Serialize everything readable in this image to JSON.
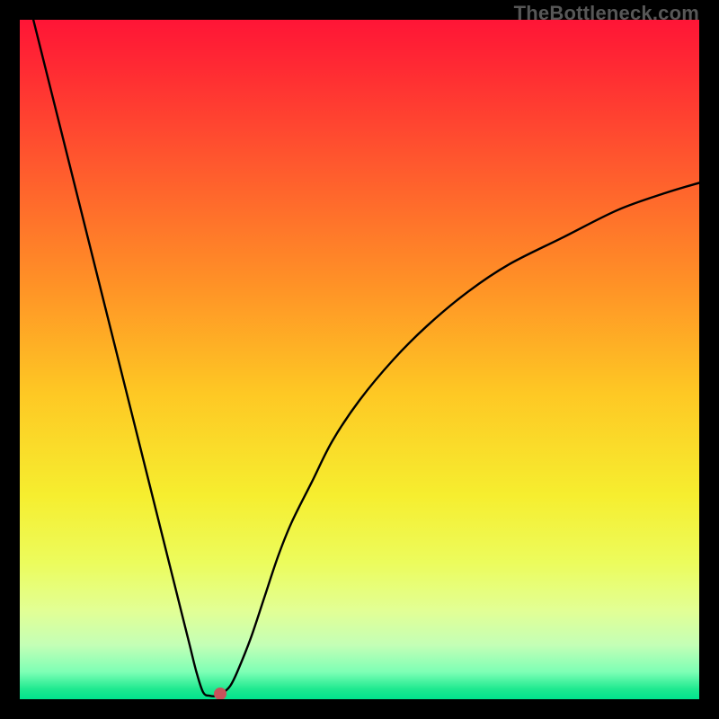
{
  "watermark": "TheBottleneck.com",
  "chart_data": {
    "type": "line",
    "title": "",
    "xlabel": "",
    "ylabel": "",
    "xlim": [
      0,
      100
    ],
    "ylim": [
      0,
      100
    ],
    "background": {
      "type": "vertical-gradient",
      "stops": [
        {
          "offset": 0.0,
          "color": "#ff1536"
        },
        {
          "offset": 0.07,
          "color": "#ff2a33"
        },
        {
          "offset": 0.23,
          "color": "#ff5e2d"
        },
        {
          "offset": 0.4,
          "color": "#ff9526"
        },
        {
          "offset": 0.55,
          "color": "#fec824"
        },
        {
          "offset": 0.7,
          "color": "#f6ee2f"
        },
        {
          "offset": 0.8,
          "color": "#ecfc5d"
        },
        {
          "offset": 0.87,
          "color": "#e2ff95"
        },
        {
          "offset": 0.92,
          "color": "#c4ffb6"
        },
        {
          "offset": 0.96,
          "color": "#7dffb5"
        },
        {
          "offset": 0.985,
          "color": "#1fe990"
        },
        {
          "offset": 1.0,
          "color": "#00e38d"
        }
      ]
    },
    "series": [
      {
        "name": "bottleneck-curve",
        "color": "#000000",
        "x": [
          2,
          4,
          6,
          8,
          10,
          12,
          14,
          16,
          18,
          20,
          22,
          24,
          25,
          26,
          27,
          28,
          29,
          30,
          31,
          32,
          34,
          36,
          38,
          40,
          43,
          46,
          50,
          55,
          60,
          66,
          72,
          80,
          88,
          95,
          100
        ],
        "y": [
          100,
          92,
          84,
          76,
          68,
          60,
          52,
          44,
          36,
          28,
          20,
          12,
          8,
          4,
          1,
          0.5,
          0.5,
          1,
          2,
          4,
          9,
          15,
          21,
          26,
          32,
          38,
          44,
          50,
          55,
          60,
          64,
          68,
          72,
          74.5,
          76
        ]
      }
    ],
    "marker": {
      "name": "optimum-point",
      "x": 29.5,
      "y": 0.8,
      "color": "#c7525b",
      "radius_px": 7
    }
  }
}
